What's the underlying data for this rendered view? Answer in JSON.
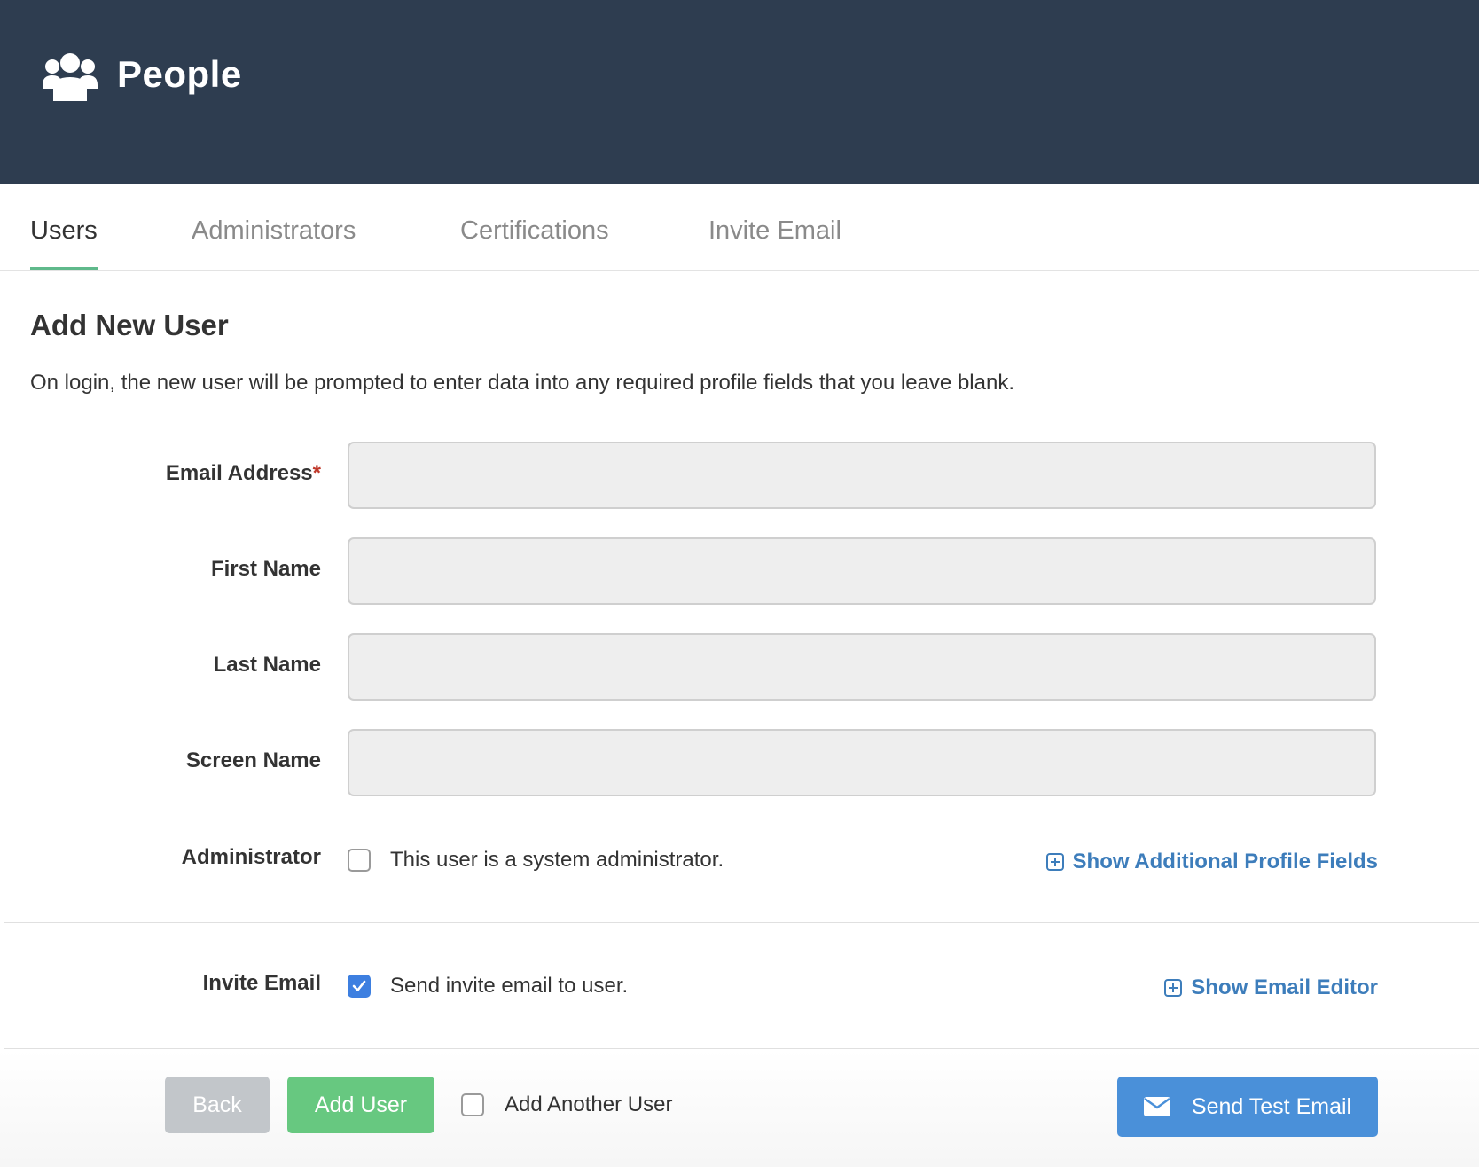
{
  "header": {
    "title": "People",
    "icon": "people-group-icon"
  },
  "tabs": [
    {
      "label": "Users",
      "active": true
    },
    {
      "label": "Administrators",
      "active": false
    },
    {
      "label": "Certifications",
      "active": false
    },
    {
      "label": "Invite Email",
      "active": false
    }
  ],
  "form": {
    "title": "Add New User",
    "description": "On login, the new user will be prompted to enter data into any required profile fields that you leave blank.",
    "fields": {
      "email": {
        "label": "Email Address",
        "required_mark": "*",
        "value": ""
      },
      "first_name": {
        "label": "First Name",
        "value": ""
      },
      "last_name": {
        "label": "Last Name",
        "value": ""
      },
      "screen_name": {
        "label": "Screen Name",
        "value": ""
      }
    },
    "administrator": {
      "label": "Administrator",
      "checkbox_text": "This user is a system administrator.",
      "checked": false,
      "link": "Show Additional Profile Fields"
    },
    "invite": {
      "label": "Invite Email",
      "checkbox_text": "Send invite email to user.",
      "checked": true,
      "link": "Show Email Editor"
    }
  },
  "footer": {
    "back_label": "Back",
    "add_label": "Add User",
    "add_another_label": "Add Another User",
    "add_another_checked": false,
    "test_email_label": "Send Test Email"
  },
  "colors": {
    "header_bg": "#2e3d50",
    "tab_accent": "#5fb98b",
    "link": "#3d7dbb",
    "add_button": "#67c880",
    "back_button": "#c2c6ca",
    "test_button": "#4a90d9",
    "checkbox_checked": "#3d7fe0",
    "required": "#c0392b"
  }
}
